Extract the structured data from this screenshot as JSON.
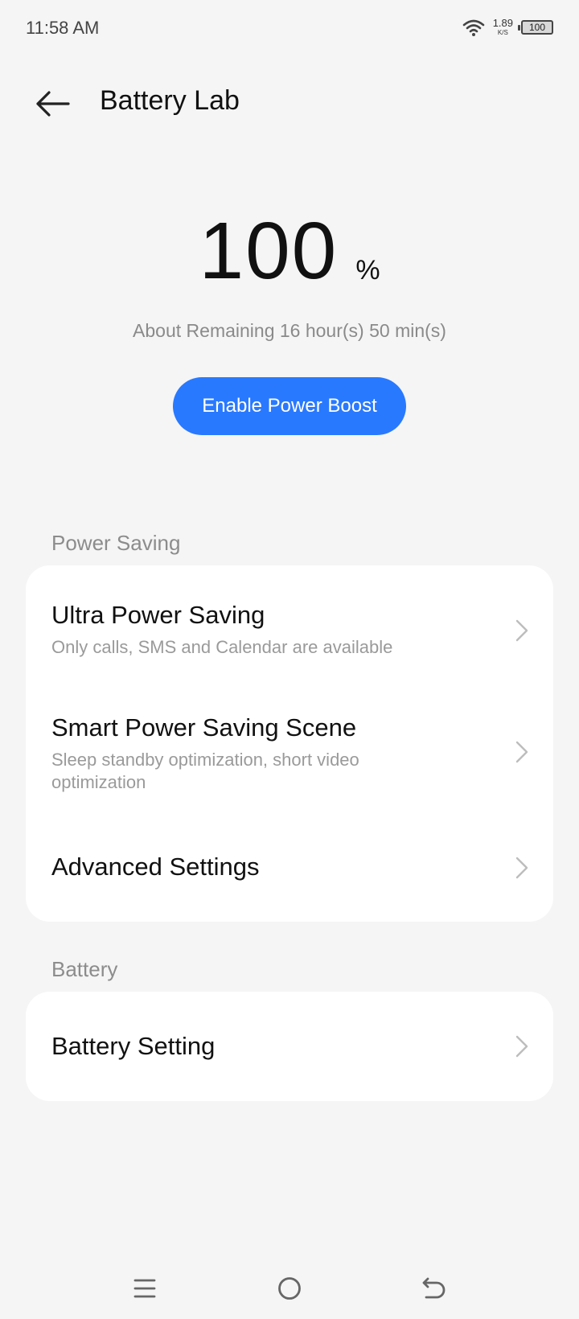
{
  "status_bar": {
    "time": "11:58 AM",
    "net_speed_value": "1.89",
    "net_speed_unit": "K/S",
    "battery_level": "100",
    "icons": [
      "wifi-icon",
      "battery-icon"
    ]
  },
  "header": {
    "title": "Battery Lab",
    "back_icon": "arrow-left-icon"
  },
  "battery": {
    "level": "100",
    "unit": "%",
    "remaining": "About Remaining 16 hour(s)  50 min(s)",
    "boost_label": "Enable Power Boost",
    "accent_color": "#2979ff"
  },
  "sections": {
    "power_saving": {
      "title": "Power Saving",
      "items": [
        {
          "title": "Ultra Power Saving",
          "subtitle": "Only calls, SMS and Calendar are available"
        },
        {
          "title": "Smart Power Saving Scene",
          "subtitle": "Sleep standby optimization, short video optimization"
        },
        {
          "title": "Advanced Settings"
        }
      ]
    },
    "battery": {
      "title": "Battery",
      "items": [
        {
          "title": "Battery Setting"
        }
      ]
    }
  },
  "nav_bar": {
    "icons": [
      "menu-icon",
      "home-icon",
      "back-nav-icon"
    ]
  }
}
